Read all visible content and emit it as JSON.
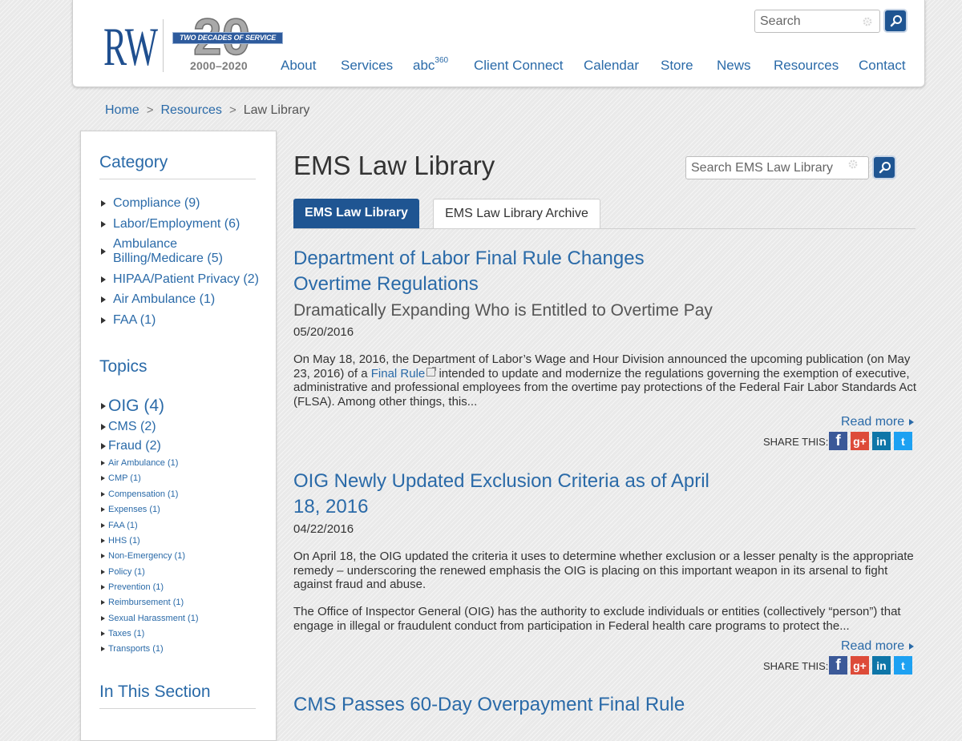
{
  "logo": {
    "initials": "RW",
    "anniversary_number": "20",
    "banner": "TWO DECADES OF SERVICE",
    "years": "2000–2020"
  },
  "header": {
    "search_placeholder": "Search",
    "nav": [
      "About",
      "Services",
      "abc",
      "Client Connect",
      "Calendar",
      "Store",
      "News",
      "Resources",
      "Contact"
    ],
    "nav_abc_sup": "360"
  },
  "breadcrumb": {
    "items": [
      "Home",
      "Resources",
      "Law Library"
    ],
    "separator": ">"
  },
  "sidebar": {
    "category_heading": "Category",
    "categories": [
      {
        "label": "Compliance (9)"
      },
      {
        "label": "Labor/Employment (6)"
      },
      {
        "label_line1": "Ambulance",
        "label_line2": "Billing/Medicare (5)"
      },
      {
        "label": "HIPAA/Patient Privacy (2)"
      },
      {
        "label": "Air Ambulance (1)"
      },
      {
        "label": "FAA (1)"
      }
    ],
    "topics_heading": "Topics",
    "topics": [
      "OIG (4)",
      "CMS (2)",
      "Fraud (2)",
      "Air Ambulance (1)",
      "CMP (1)",
      "Compensation (1)",
      "Expenses (1)",
      "FAA (1)",
      "HHS (1)",
      "Non-Emergency (1)",
      "Policy (1)",
      "Prevention (1)",
      "Reimbursement (1)",
      "Sexual Harassment (1)",
      "Taxes (1)",
      "Transports (1)"
    ],
    "section_heading": "In This Section"
  },
  "main": {
    "title": "EMS Law Library",
    "search_placeholder": "Search EMS Law Library",
    "tabs": [
      "EMS Law Library",
      "EMS Law Library Archive"
    ],
    "share_label": "SHARE THIS:",
    "read_more": "Read more",
    "articles": [
      {
        "title_line1": "Department of Labor Final Rule Changes",
        "title_line2": "Overtime Regulations",
        "subtitle": "Dramatically Expanding Who is Entitled to Overtime Pay",
        "date": "05/20/2016",
        "body_before_link": "On May 18, 2016, the Department of Labor’s Wage and Hour Division announced the upcoming publication (on May 23, 2016) of a ",
        "link_text": "Final Rule",
        "body_after_link": " intended to update and modernize the regulations governing the exemption of executive, administrative and professional employees from the overtime pay protections of the Federal Fair Labor Standards Act (FLSA).  Among other things, this..."
      },
      {
        "title_line1": "OIG Newly Updated Exclusion Criteria as of April",
        "title_line2": "18, 2016",
        "date": "04/22/2016",
        "body_p1": "On April 18, the OIG updated the criteria it uses to determine whether exclusion or a lesser penalty is the appropriate remedy – underscoring the renewed emphasis the OIG is placing on this important weapon in its arsenal to fight against fraud and abuse.",
        "body_p2": "The Office of Inspector General (OIG) has the authority to exclude individuals or entities (collectively “person”) that engage in illegal or fraudulent conduct from participation in Federal health care programs to protect the..."
      },
      {
        "title_line1": "CMS Passes 60-Day Overpayment Final Rule"
      }
    ]
  },
  "colors": {
    "link": "#2a6aa8",
    "brand_navy": "#1f5592",
    "facebook": "#3b5998",
    "google_plus": "#dd4b39",
    "linkedin": "#0e76a8",
    "twitter": "#1da1f2"
  },
  "icons": [
    "search-icon",
    "gear-icon",
    "external-link-icon",
    "facebook-icon",
    "google-plus-icon",
    "linkedin-icon",
    "twitter-icon"
  ]
}
